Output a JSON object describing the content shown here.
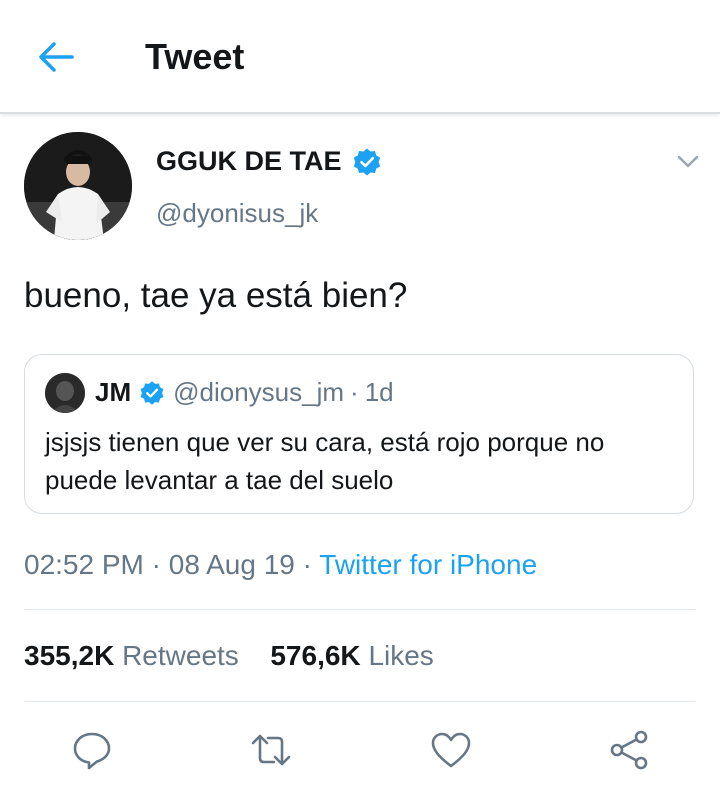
{
  "header": {
    "title": "Tweet",
    "back_icon": "arrow-left-icon"
  },
  "colors": {
    "accent": "#1da1f2",
    "secondary_text": "#657786",
    "primary_text": "#14171a",
    "divider": "#e1e8ed"
  },
  "tweet": {
    "author_name": "GGUK DE TAE",
    "author_handle": "@dyonisus_jk",
    "verified": true,
    "text": "bueno, tae ya está bien?",
    "time": "02:52 PM",
    "date": "08 Aug 19",
    "source": "Twitter for iPhone",
    "separator": "·"
  },
  "quoted": {
    "name": "JM",
    "handle": "@dionysus_jm",
    "separator": "·",
    "age": "1d",
    "text": "jsjsjs tienen que ver su cara, está rojo porque no puede levantar a tae del suelo"
  },
  "stats": {
    "retweets_count": "355,2K",
    "retweets_label": "Retweets",
    "likes_count": "576,6K",
    "likes_label": "Likes"
  },
  "actions": [
    "reply-icon",
    "retweet-icon",
    "like-icon",
    "share-icon"
  ]
}
